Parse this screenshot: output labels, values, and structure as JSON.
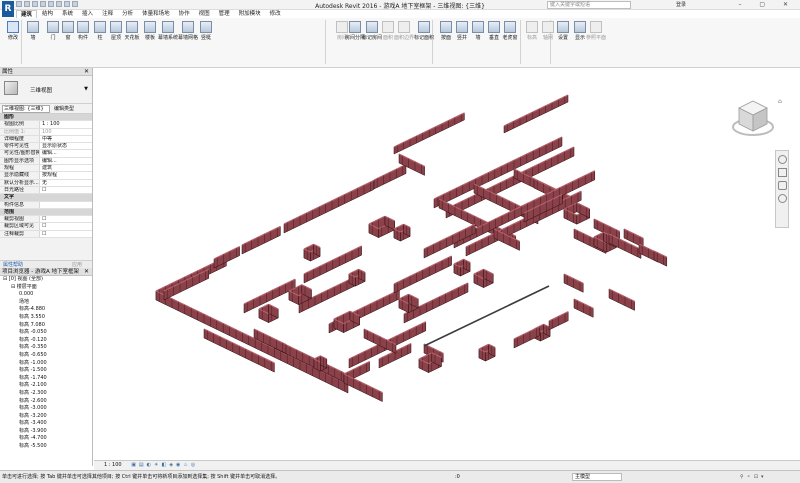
{
  "window": {
    "title": "Autodesk Revit 2016 -  游戏A 地下室框架 - 三维视图: {三维}",
    "search_placeholder": "键入关键字或短语",
    "login": "登录"
  },
  "tabs": [
    "建筑",
    "结构",
    "系统",
    "插入",
    "注释",
    "分析",
    "体量和场地",
    "协作",
    "视图",
    "管理",
    "附加模块",
    "修改"
  ],
  "ribbon": {
    "buttons": [
      {
        "label": "修改",
        "state": "sel"
      },
      {
        "label": "墙",
        "state": ""
      },
      {
        "label": "门",
        "state": ""
      },
      {
        "label": "窗",
        "state": ""
      },
      {
        "label": "构件",
        "state": ""
      },
      {
        "label": "柱",
        "state": ""
      },
      {
        "label": "屋顶",
        "state": ""
      },
      {
        "label": "天花板",
        "state": ""
      },
      {
        "label": "楼板",
        "state": ""
      },
      {
        "label": "幕墙系统",
        "state": ""
      },
      {
        "label": "幕墙网格",
        "state": ""
      },
      {
        "label": "竖梃",
        "state": ""
      },
      {
        "label": "房间",
        "state": "dis"
      },
      {
        "label": "房间分隔",
        "state": ""
      },
      {
        "label": "标记房间",
        "state": ""
      },
      {
        "label": "面积",
        "state": "dis"
      },
      {
        "label": "面积边界",
        "state": "dis"
      },
      {
        "label": "标记面积",
        "state": ""
      },
      {
        "label": "按面",
        "state": ""
      },
      {
        "label": "竖井",
        "state": ""
      },
      {
        "label": "墙",
        "state": ""
      },
      {
        "label": "垂直",
        "state": ""
      },
      {
        "label": "老虎窗",
        "state": ""
      },
      {
        "label": "标高",
        "state": "dis"
      },
      {
        "label": "轴网",
        "state": "dis"
      },
      {
        "label": "设置",
        "state": ""
      },
      {
        "label": "显示",
        "state": ""
      },
      {
        "label": "参照平面",
        "state": "dis"
      }
    ]
  },
  "properties": {
    "header": "属性",
    "type_name": "三维视图",
    "view_dropdown": "三维视图: {三维}",
    "edit_type": "编辑类型",
    "rows": [
      {
        "k": "图形",
        "v": "",
        "cat": true
      },
      {
        "k": "视图比例",
        "v": "1 : 100"
      },
      {
        "k": "比例值 1:",
        "v": "100",
        "dim": true
      },
      {
        "k": "详细程度",
        "v": "中等"
      },
      {
        "k": "零件可见性",
        "v": "显示原状态"
      },
      {
        "k": "可见性/图形替换",
        "v": "编辑..."
      },
      {
        "k": "图形显示选项",
        "v": "编辑..."
      },
      {
        "k": "规程",
        "v": "建筑"
      },
      {
        "k": "显示隐藏线",
        "v": "按规程"
      },
      {
        "k": "默认分析显示...",
        "v": "无"
      },
      {
        "k": "日光路径",
        "v": "☐"
      },
      {
        "k": "文字",
        "v": "",
        "cat": true
      },
      {
        "k": "构件信息",
        "v": ""
      },
      {
        "k": "范围",
        "v": "",
        "cat": true
      },
      {
        "k": "裁剪视图",
        "v": "☐"
      },
      {
        "k": "裁剪区域可见",
        "v": "☐"
      },
      {
        "k": "注释裁剪",
        "v": "☐"
      }
    ],
    "help": "属性帮助",
    "apply": "应用"
  },
  "browser": {
    "header": "项目浏览器 - 游戏A 地下室框架",
    "nodes": [
      {
        "t": "⊟ [0] 视图 (全部)",
        "lvl": 0
      },
      {
        "t": "⊟ 楼层平面",
        "lvl": 1
      },
      {
        "t": "0.000",
        "lvl": 2
      },
      {
        "t": "场地",
        "lvl": 2
      },
      {
        "t": "标高-4.880",
        "lvl": 2
      },
      {
        "t": "标高 3.550",
        "lvl": 2
      },
      {
        "t": "标高 7.080",
        "lvl": 2
      },
      {
        "t": "标高 -0.050",
        "lvl": 2
      },
      {
        "t": "标高 -0.120",
        "lvl": 2
      },
      {
        "t": "标高 -0.350",
        "lvl": 2
      },
      {
        "t": "标高 -0.650",
        "lvl": 2
      },
      {
        "t": "标高 -1.000",
        "lvl": 2
      },
      {
        "t": "标高 -1.500",
        "lvl": 2
      },
      {
        "t": "标高 -1.740",
        "lvl": 2
      },
      {
        "t": "标高 -2.100",
        "lvl": 2
      },
      {
        "t": "标高 -2.300",
        "lvl": 2
      },
      {
        "t": "标高 -2.600",
        "lvl": 2
      },
      {
        "t": "标高 -3.000",
        "lvl": 2
      },
      {
        "t": "标高 -3.200",
        "lvl": 2
      },
      {
        "t": "标高 -3.400",
        "lvl": 2
      },
      {
        "t": "标高 -3.900",
        "lvl": 2
      },
      {
        "t": "标高 -4.700",
        "lvl": 2
      },
      {
        "t": "标高 -5.500",
        "lvl": 2
      }
    ]
  },
  "view_bar": {
    "scale": "1 : 100"
  },
  "status": {
    "message": "单击可进行选择; 按 Tab 键并单击可选择其他项目; 按 Ctrl 键并单击可将新项目添加到选择集; 按 Shift 键并单击可取消选择。",
    "zero": ":0",
    "model": "主模型"
  },
  "colors": {
    "wall": "#8a4149",
    "wall_top": "#b3606a",
    "edge": "#2a0c10",
    "accent": "#1b5a9b"
  }
}
